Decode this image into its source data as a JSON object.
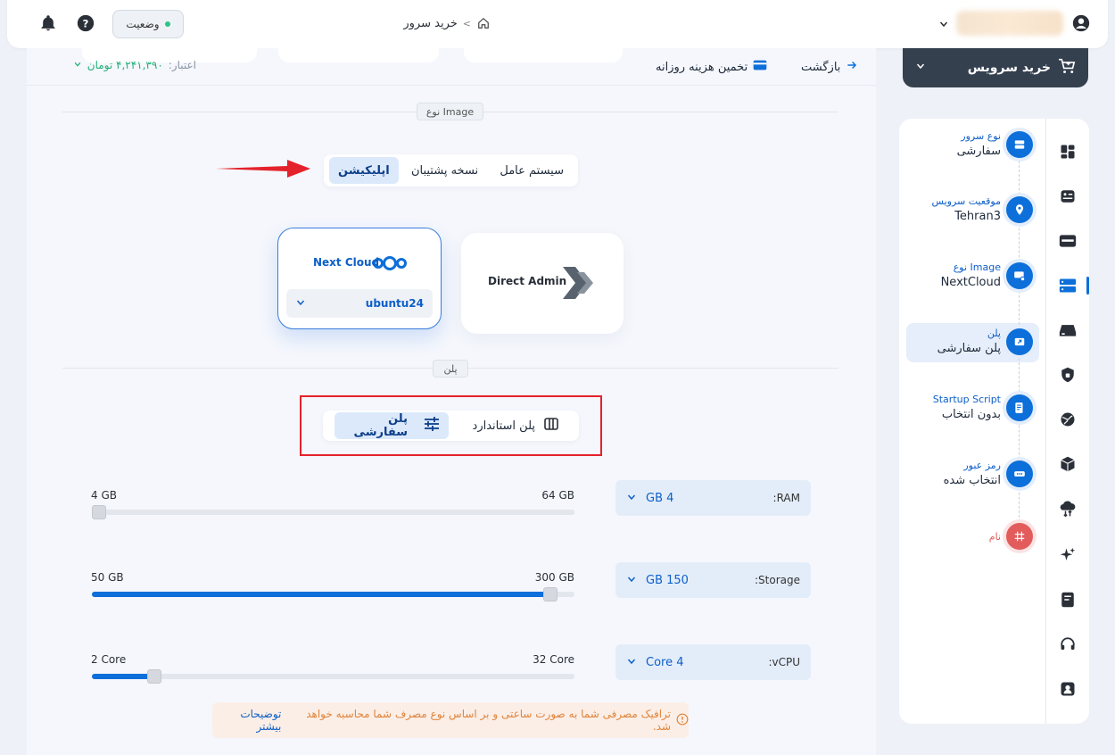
{
  "topbar": {
    "status_label": "وضعیت",
    "breadcrumb_page": "خرید سرور",
    "breadcrumb_separator": ">"
  },
  "toolbar": {
    "back_label": "بازگشت",
    "estimate_label": "تخمین هزینه روزانه",
    "credit_label": "اعتبار:",
    "credit_value": "۴,۲۴۱,۳۹۰ تومان"
  },
  "image_section": {
    "label": "نوع Image",
    "tabs": [
      "سیستم عامل",
      "نسخه پشتیبان",
      "اپلیکیشن"
    ],
    "active_tab": "اپلیکیشن",
    "apps": [
      {
        "name": "Next Cloud",
        "version": "ubuntu24",
        "selected": true
      },
      {
        "name": "Direct Admin",
        "selected": false
      }
    ]
  },
  "plan_section": {
    "label": "پلن",
    "tabs": [
      "پلن استاندارد",
      "پلن سفارشی"
    ],
    "active_tab": "پلن سفارشی"
  },
  "specs": [
    {
      "key": "RAM:",
      "value": "4 GB",
      "min": "4 GB",
      "max": "64 GB",
      "fill": 0.0
    },
    {
      "key": "Storage:",
      "value": "150 GB",
      "min": "50 GB",
      "max": "300 GB",
      "fill": 0.95
    },
    {
      "key": "vCPU:",
      "value": "4 Core",
      "min": "2 Core",
      "max": "32 Core",
      "fill": 0.13
    }
  ],
  "notice": {
    "text": "ترافیک مصرفی شما به صورت ساعتی و بر اساس نوع مصرف شما محاسبه خواهد شد.",
    "link": "توضیحات بیشتر"
  },
  "sidebar": {
    "buy_label": "خرید سرویس",
    "steps": [
      {
        "title": "نوع سرور",
        "value": "سفارشی"
      },
      {
        "title": "موقعیت سرویس",
        "value": "Tehran3"
      },
      {
        "title": "نوع Image",
        "value": "NextCloud"
      },
      {
        "title": "پلن",
        "value": "پلن سفارشی"
      },
      {
        "title": "Startup Script",
        "value": "بدون انتخاب"
      },
      {
        "title": "رمز عبور",
        "value": "انتخاب شده"
      },
      {
        "title": "نام",
        "value": ""
      }
    ]
  },
  "colors": {
    "accent": "#0d6fd9",
    "dark": "#35404f",
    "danger": "#e4222b",
    "success": "#22b077"
  }
}
